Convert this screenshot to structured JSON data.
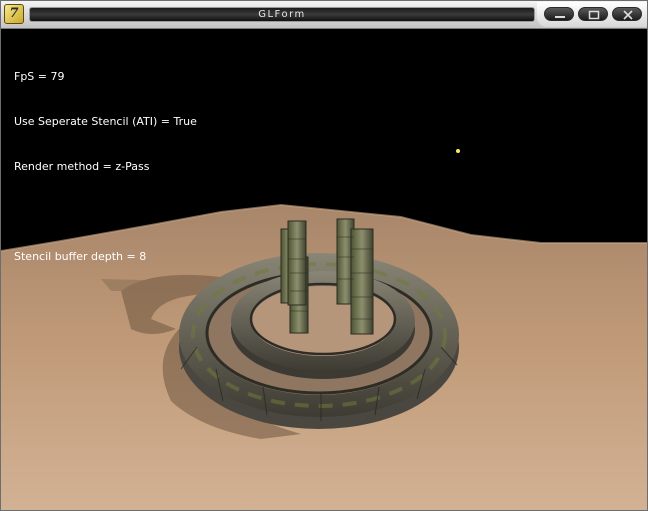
{
  "window": {
    "title": "GLForm",
    "icon": "delphi-app-icon",
    "controls": [
      "minimize-icon",
      "maximize-icon",
      "close-icon"
    ]
  },
  "hud": {
    "fps": "FpS = 79",
    "stencil": "Use Seperate Stencil (ATI) = True",
    "render_method": "Render method = z-Pass",
    "blank": "",
    "stencil_depth": "Stencil buffer depth = 8"
  },
  "scene": {
    "sky_color": "#000000",
    "terrain_color": "#b38e6c",
    "stone_color": "#5e5a4e",
    "moss_color": "#6f7a3c",
    "light_color": "#ffea5a"
  }
}
